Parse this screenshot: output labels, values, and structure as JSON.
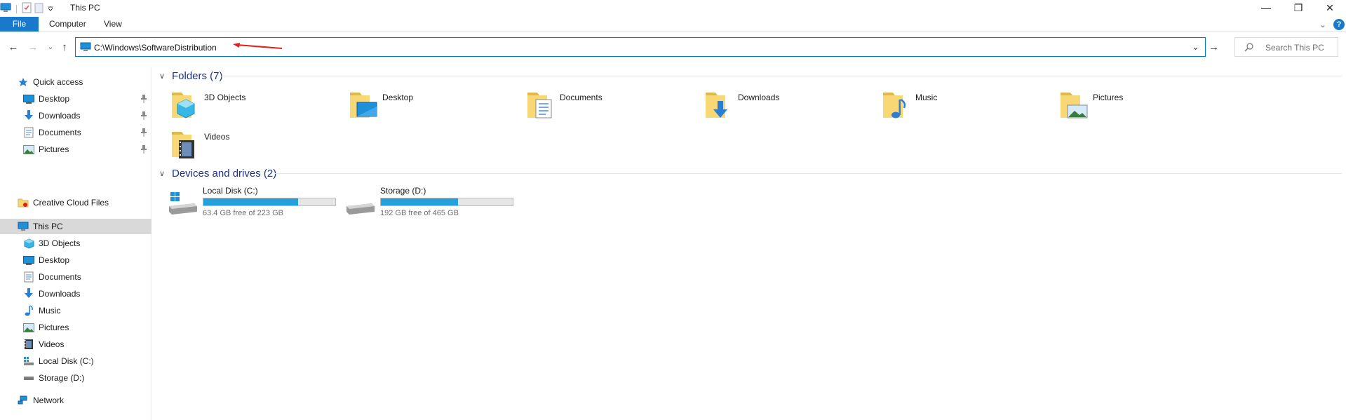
{
  "window": {
    "title": "This PC",
    "minimize": "—",
    "restore": "❐",
    "close": "✕"
  },
  "ribbon": {
    "tabs": [
      "File",
      "Computer",
      "View"
    ],
    "collapse_glyph": "⌄",
    "help_glyph": "?"
  },
  "address_bar": {
    "value": "C:\\Windows\\SoftwareDistribution",
    "dropdown_glyph": "⌄",
    "go_glyph": "→"
  },
  "search": {
    "placeholder": "Search This PC"
  },
  "nav_buttons": {
    "back": "←",
    "forward": "→",
    "recent": "⌄",
    "up": "↑"
  },
  "annotation": {
    "arrow_color": "#e02020"
  },
  "sidebar": {
    "quick_access": {
      "label": "Quick access",
      "items": [
        {
          "label": "Desktop",
          "icon": "desktop-icon",
          "pinned": true
        },
        {
          "label": "Downloads",
          "icon": "downloads-icon",
          "pinned": true
        },
        {
          "label": "Documents",
          "icon": "documents-icon",
          "pinned": true
        },
        {
          "label": "Pictures",
          "icon": "pictures-icon",
          "pinned": true
        }
      ]
    },
    "creative_cloud": {
      "label": "Creative Cloud Files"
    },
    "this_pc": {
      "label": "This PC",
      "items": [
        {
          "label": "3D Objects",
          "icon": "3d-objects-icon"
        },
        {
          "label": "Desktop",
          "icon": "desktop-icon"
        },
        {
          "label": "Documents",
          "icon": "documents-icon"
        },
        {
          "label": "Downloads",
          "icon": "downloads-icon"
        },
        {
          "label": "Music",
          "icon": "music-icon"
        },
        {
          "label": "Pictures",
          "icon": "pictures-icon"
        },
        {
          "label": "Videos",
          "icon": "videos-icon"
        },
        {
          "label": "Local Disk (C:)",
          "icon": "local-disk-icon"
        },
        {
          "label": "Storage (D:)",
          "icon": "drive-icon"
        }
      ]
    },
    "network": {
      "label": "Network"
    }
  },
  "content": {
    "folders_header": "Folders (7)",
    "folders": [
      {
        "name": "3D Objects",
        "icon": "3d-objects-folder-icon"
      },
      {
        "name": "Desktop",
        "icon": "desktop-folder-icon"
      },
      {
        "name": "Documents",
        "icon": "documents-folder-icon"
      },
      {
        "name": "Downloads",
        "icon": "downloads-folder-icon"
      },
      {
        "name": "Music",
        "icon": "music-folder-icon"
      },
      {
        "name": "Pictures",
        "icon": "pictures-folder-icon"
      },
      {
        "name": "Videos",
        "icon": "videos-folder-icon"
      }
    ],
    "drives_header": "Devices and drives (2)",
    "drives": [
      {
        "name": "Local Disk (C:)",
        "free_text": "63.4 GB free of 223 GB",
        "used_fraction": 0.716
      },
      {
        "name": "Storage (D:)",
        "free_text": "192 GB free of 465 GB",
        "used_fraction": 0.587
      }
    ]
  },
  "colors": {
    "accent": "#1979ca",
    "selection": "#d9d9d9",
    "drive_fill": "#26a0da",
    "header_text": "#1e3287",
    "folder_yellow": "#f8d775"
  }
}
